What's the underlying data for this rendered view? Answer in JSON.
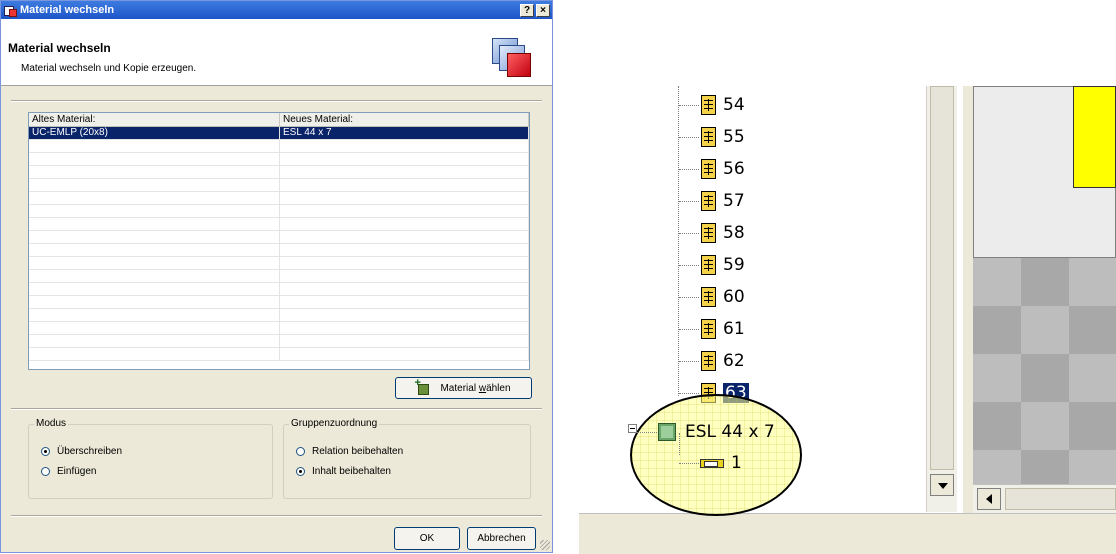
{
  "dialog": {
    "title": "Material wechseln",
    "help_button": "?",
    "close_button": "×",
    "header_title": "Material wechseln",
    "header_subtitle": "Material wechseln und Kopie erzeugen.",
    "table": {
      "columns": [
        "Altes Material:",
        "Neues Material:"
      ],
      "rows": [
        [
          "UC-EMLP (20x8)",
          "ESL 44 x 7"
        ]
      ]
    },
    "choose_material_prefix": "Material ",
    "choose_material_hotkey": "w",
    "choose_material_suffix": "ählen",
    "modus": {
      "legend": "Modus",
      "options": [
        "Überschreiben",
        "Einfügen"
      ],
      "selected": "Überschreiben"
    },
    "gruppe": {
      "legend": "Gruppenzuordnung",
      "options": [
        "Relation beibehalten",
        "Inhalt beibehalten"
      ],
      "selected": "Inhalt beibehalten"
    },
    "ok_label": "OK",
    "cancel_label": "Abbrechen"
  },
  "tree": {
    "items": [
      "54",
      "55",
      "56",
      "57",
      "58",
      "59",
      "60",
      "61",
      "62",
      "63"
    ],
    "selected_item": "63",
    "parent_node": "ESL 44 x 7",
    "child_node": "1"
  },
  "colors": {
    "selection": "#0a246a",
    "title_bar": "#1d55c8",
    "canvas_yellow": "#ffff00",
    "magnifier": "#ffff8c"
  }
}
